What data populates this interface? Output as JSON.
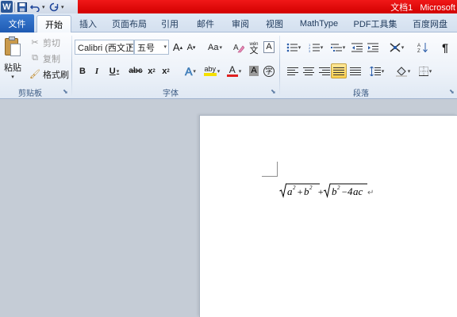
{
  "window": {
    "title": "文档1",
    "app": "Microsoft"
  },
  "quick_access": {
    "logo": "W",
    "save_icon": "save-icon",
    "undo_icon": "undo-icon",
    "redo_icon": "redo-icon"
  },
  "tabs": {
    "file": "文件",
    "items": [
      "开始",
      "插入",
      "页面布局",
      "引用",
      "邮件",
      "审阅",
      "视图",
      "MathType",
      "PDF工具集",
      "百度网盘"
    ],
    "active": "开始"
  },
  "clipboard": {
    "paste": "粘贴",
    "cut": "剪切",
    "copy": "复制",
    "format_painter": "格式刷",
    "group_label": "剪贴板"
  },
  "font": {
    "name": "Calibri (西文正",
    "size": "五号",
    "grow": "A",
    "shrink": "A",
    "change_case": "Aa",
    "clear_format": "clear-format-icon",
    "phonetic": "wén",
    "char_border": "A",
    "bold": "B",
    "italic": "I",
    "underline": "U",
    "strikethrough": "abc",
    "subscript": "x",
    "superscript": "x",
    "text_effects": "A",
    "highlight": "aby",
    "font_color": "A",
    "char_shading": "A",
    "enclose": "字",
    "group_label": "字体",
    "font_color_value": "#e02020",
    "highlight_color_value": "#f5e000"
  },
  "paragraph": {
    "group_label": "段落"
  },
  "document": {
    "formula": {
      "sqrt1": "a² + b²",
      "plus": "+",
      "sqrt2": "b² − 4ac"
    },
    "paragraph_mark": "↵"
  }
}
